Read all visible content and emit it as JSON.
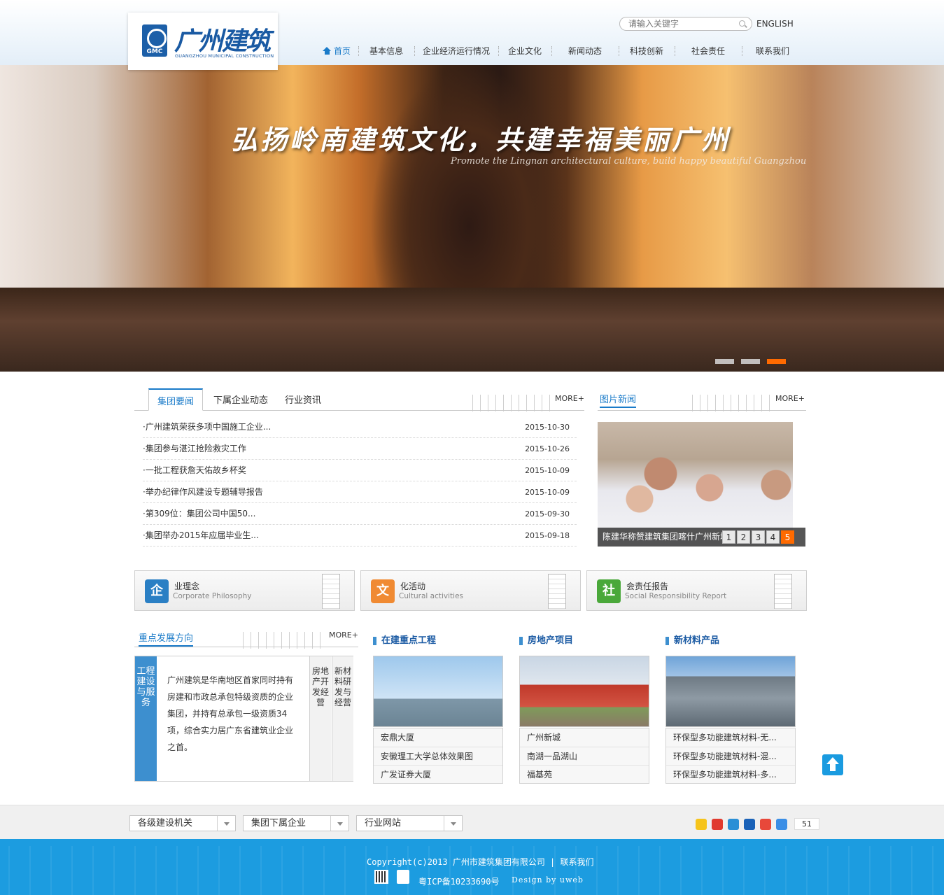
{
  "header": {
    "logo_text": "广州建筑",
    "logo_gmc": "GMC",
    "logo_en": "GUANGZHOU MUNICIPAL CONSTRUCTION",
    "search_placeholder": "请输入关键字",
    "english_label": "ENGLISH",
    "nav": [
      "首页",
      "基本信息",
      "企业经济运行情况",
      "企业文化",
      "新闻动态",
      "科技创新",
      "社会责任",
      "联系我们"
    ]
  },
  "banner": {
    "slogan": "弘扬岭南建筑文化，共建幸福美丽广州",
    "slogan_en": "Promote the Lingnan architectural culture, build happy beautiful Guangzhou",
    "slides": 3,
    "active_slide": 3
  },
  "news": {
    "tabs": [
      "集团要闻",
      "下属企业动态",
      "行业资讯"
    ],
    "active_tab": 0,
    "more": "MORE+",
    "items": [
      {
        "title": "·广州建筑荣获多项中国施工企业...",
        "date": "2015-10-30"
      },
      {
        "title": "·集团参与湛江抢险救灾工作",
        "date": "2015-10-26"
      },
      {
        "title": "·一批工程获詹天佑故乡杯奖",
        "date": "2015-10-09"
      },
      {
        "title": "·举办纪律作风建设专题辅导报告",
        "date": "2015-10-09"
      },
      {
        "title": "·第309位：集团公司中国50...",
        "date": "2015-09-30"
      },
      {
        "title": "·集团举办2015年应届毕业生...",
        "date": "2015-09-18"
      }
    ]
  },
  "picnews": {
    "title": "图片新闻",
    "more": "MORE+",
    "caption": "陈建华称赞建筑集团喀什广州新城",
    "pages": [
      "1",
      "2",
      "3",
      "4",
      "5"
    ],
    "active_page": 5
  },
  "culture": [
    {
      "icon": "企",
      "title": "业理念",
      "en": "Corporate Philosophy",
      "color": "#2a7fc4"
    },
    {
      "icon": "文",
      "title": "化活动",
      "en": "Cultural activities",
      "color": "#f08a32"
    },
    {
      "icon": "社",
      "title": "会责任报告",
      "en": "Social Responsibility Report",
      "color": "#4aa83a"
    }
  ],
  "focus": {
    "title": "重点发展方向",
    "more": "MORE+",
    "active_label": "工程建设与服务",
    "text": "广州建筑是华南地区首家同时持有房建和市政总承包特级资质的企业集团，并持有总承包一级资质34项，综合实力居广东省建筑业企业之首。",
    "tab2": "房地产开发经营",
    "tab3": "新材料研发与经营"
  },
  "projects": [
    {
      "title": "在建重点工程",
      "items": [
        "宏鼎大厦",
        "安徽理工大学总体效果图",
        "广发证券大厦"
      ]
    },
    {
      "title": "房地产项目",
      "items": [
        "广州新城",
        "南湖一品湖山",
        "福基苑"
      ]
    },
    {
      "title": "新材料产品",
      "items": [
        "环保型多功能建筑材料-无...",
        "环保型多功能建筑材料-混...",
        "环保型多功能建筑材料-多..."
      ]
    }
  ],
  "links": {
    "selects": [
      "各级建设机关",
      "集团下属企业",
      "行业网站"
    ],
    "share_count": "51",
    "share_icons": [
      "qzone-icon",
      "weibo-icon",
      "tencent-weibo-icon",
      "renren-icon",
      "tencent-icon",
      "more-share-icon"
    ]
  },
  "footer": {
    "copyright": "Copyright(c)2013 广州市建筑集团有限公司 | 联系我们",
    "icp": "粤ICP备10233690号",
    "design": "Design by uweb"
  },
  "colors": {
    "brand": "#1a7bc9",
    "accent": "#ff6a00",
    "footer": "#1c9ce0"
  }
}
